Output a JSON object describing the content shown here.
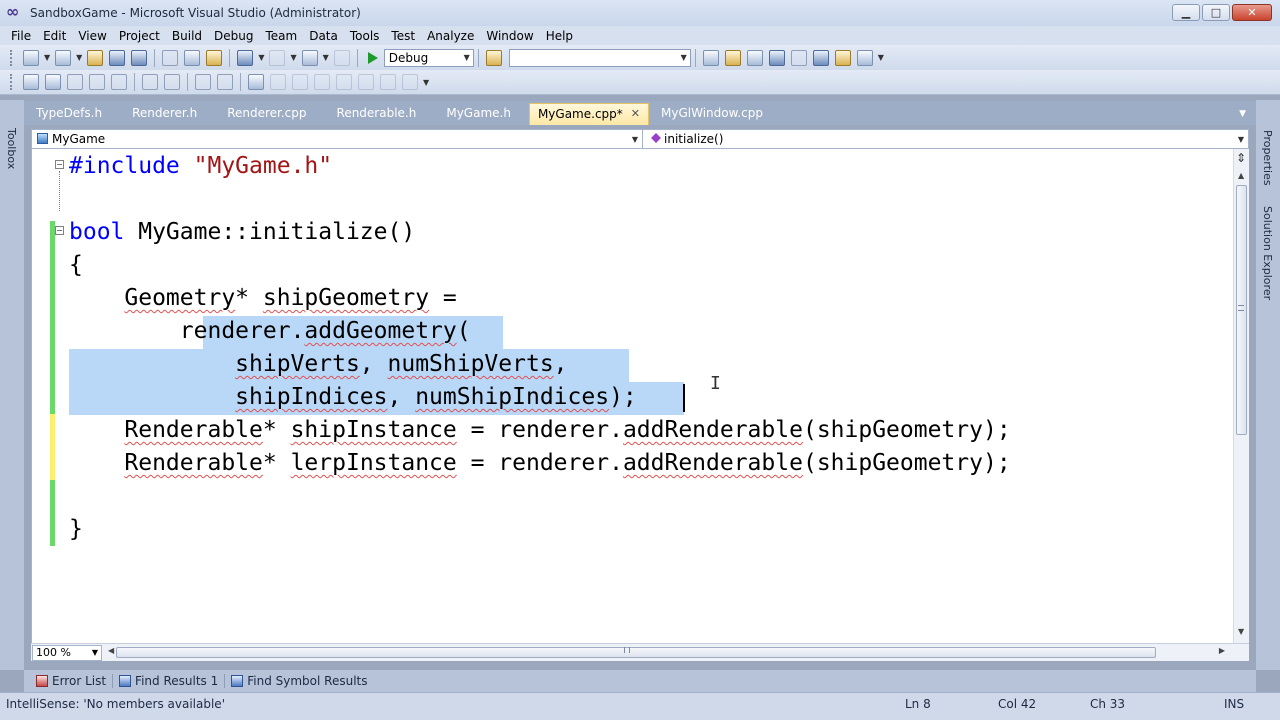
{
  "window": {
    "title": "SandboxGame - Microsoft Visual Studio (Administrator)",
    "minimize": "▁",
    "maximize": "□",
    "close": "✕"
  },
  "menu": [
    "File",
    "Edit",
    "View",
    "Project",
    "Build",
    "Debug",
    "Team",
    "Data",
    "Tools",
    "Test",
    "Analyze",
    "Window",
    "Help"
  ],
  "toolbar": {
    "config": "Debug",
    "platform": ""
  },
  "side": {
    "left_tab": "Toolbox",
    "right_tab1": "Properties",
    "right_tab2": "Solution Explorer"
  },
  "tabs": [
    {
      "label": "TypeDefs.h",
      "active": false
    },
    {
      "label": "Renderer.h",
      "active": false
    },
    {
      "label": "Renderer.cpp",
      "active": false
    },
    {
      "label": "Renderable.h",
      "active": false
    },
    {
      "label": "MyGame.h",
      "active": false
    },
    {
      "label": "MyGame.cpp*",
      "active": true
    },
    {
      "label": "MyGlWindow.cpp",
      "active": false
    }
  ],
  "nav": {
    "scope": "MyGame",
    "member": "initialize()"
  },
  "code": {
    "line1_directive": "#include",
    "line1_string": "\"MyGame.h\"",
    "l3_kw": "bool",
    "l3_rest": " MyGame::initialize()",
    "l4": "{",
    "l5_type": "Geometry",
    "l5_mid": "* ",
    "l5_var": "shipGeometry",
    "l5_end": " =",
    "l6_obj": "renderer",
    "l6_dot": ".",
    "l6_fn": "addGeometry",
    "l6_end": "(",
    "l7_a": "shipVerts",
    "l7_sep": ", ",
    "l7_b": "numShipVerts",
    "l7_end": ",",
    "l8_a": "shipIndices",
    "l8_sep": ", ",
    "l8_b": "numShipIndices",
    "l8_end": ");",
    "l9_type": "Renderable",
    "l9_mid": "* ",
    "l9_var": "shipInstance",
    "l9_eq": " = ",
    "l9_obj": "renderer",
    "l9_dot": ".",
    "l9_fn": "addRenderable",
    "l9_arg_open": "(",
    "l9_arg": "shipGeometry",
    "l9_end": ");",
    "l10_type": "Renderable",
    "l10_mid": "* ",
    "l10_var": "lerpInstance",
    "l10_eq": " = ",
    "l10_obj": "renderer",
    "l10_dot": ".",
    "l10_fn": "addRenderable",
    "l10_arg_open": "(",
    "l10_arg": "shipGeometry",
    "l10_end": ");",
    "l12": "}"
  },
  "zoom": "100 %",
  "bottom_tabs": [
    "Error List",
    "Find Results 1",
    "Find Symbol Results"
  ],
  "status": {
    "message": "IntelliSense: 'No members available'",
    "ln": "Ln 8",
    "col": "Col 42",
    "ch": "Ch 33",
    "mode": "INS"
  }
}
